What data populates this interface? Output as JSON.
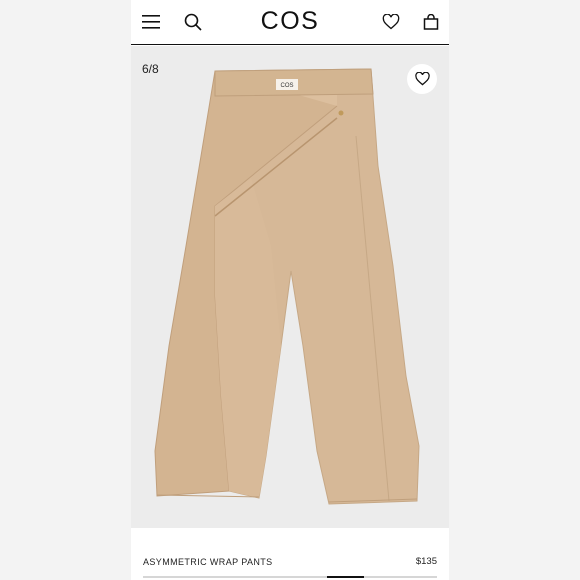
{
  "header": {
    "brand": "COS",
    "icons": {
      "menu": "menu-icon",
      "search": "search-icon",
      "wishlist": "heart-icon",
      "bag": "bag-icon"
    }
  },
  "gallery": {
    "counter": "6/8",
    "current_image": 6,
    "total_images": 8,
    "label_tag": "COS"
  },
  "product": {
    "name": "ASYMMETRIC WRAP PANTS",
    "price": "$135",
    "color": "#d7b998"
  },
  "colors": {
    "background": "#ececec",
    "text": "#111111"
  }
}
